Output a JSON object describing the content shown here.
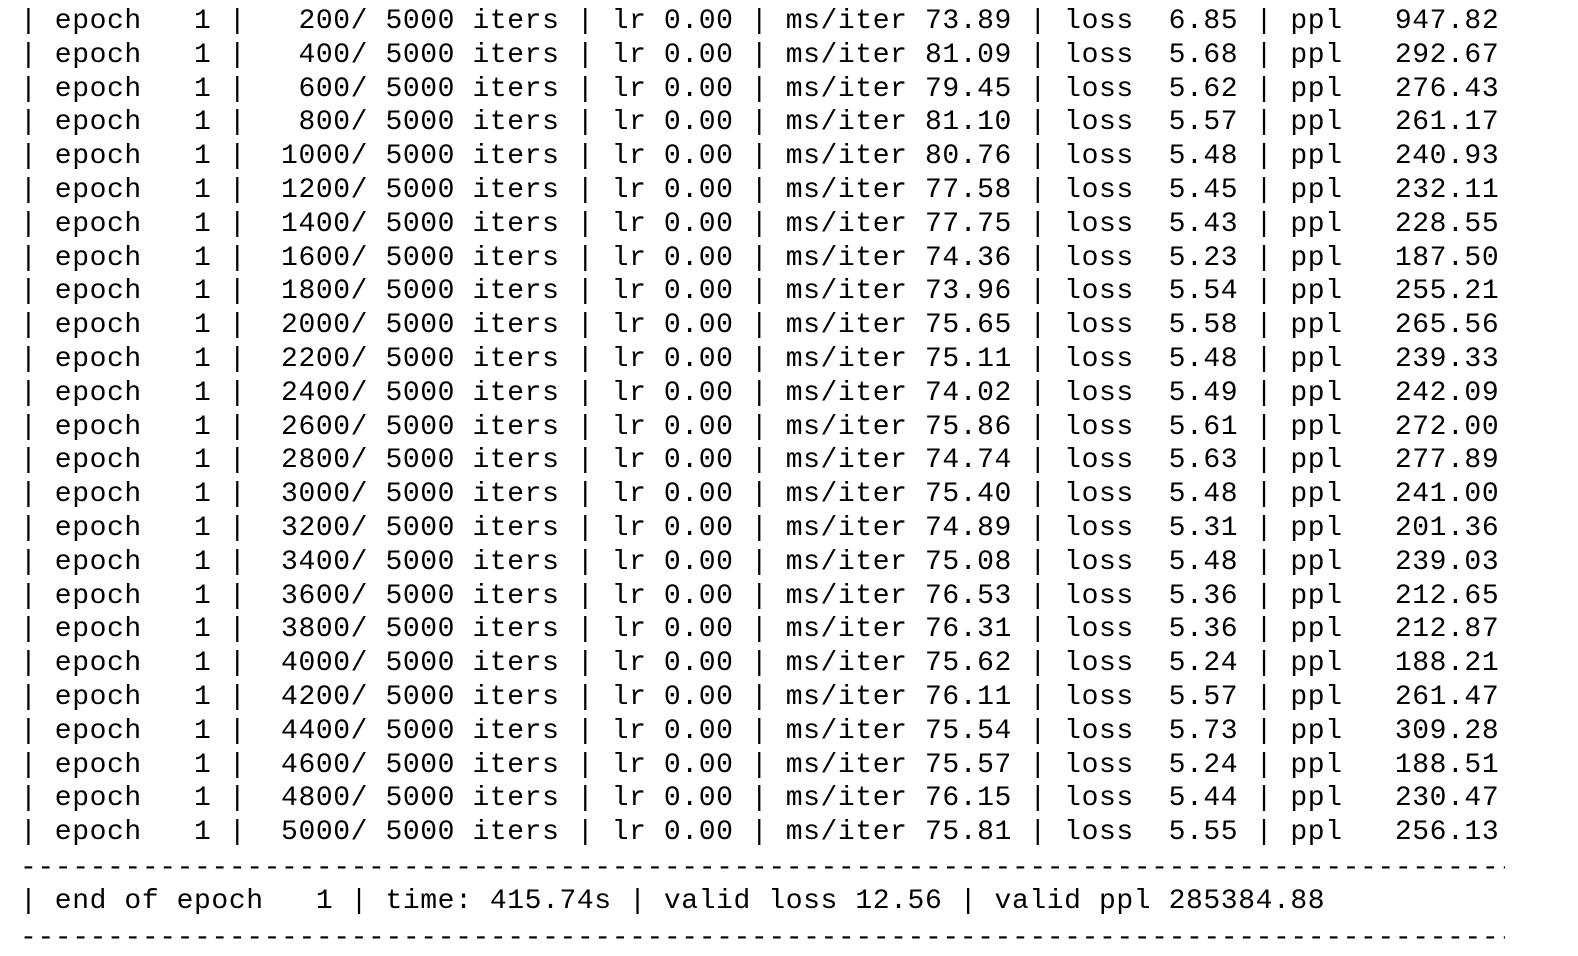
{
  "terminal": {
    "lines": [
      "| epoch   1 |   200/ 5000 iters | lr 0.00 | ms/iter 73.89 | loss  6.85 | ppl   947.82",
      "| epoch   1 |   400/ 5000 iters | lr 0.00 | ms/iter 81.09 | loss  5.68 | ppl   292.67",
      "| epoch   1 |   600/ 5000 iters | lr 0.00 | ms/iter 79.45 | loss  5.62 | ppl   276.43",
      "| epoch   1 |   800/ 5000 iters | lr 0.00 | ms/iter 81.10 | loss  5.57 | ppl   261.17",
      "| epoch   1 |  1000/ 5000 iters | lr 0.00 | ms/iter 80.76 | loss  5.48 | ppl   240.93",
      "| epoch   1 |  1200/ 5000 iters | lr 0.00 | ms/iter 77.58 | loss  5.45 | ppl   232.11",
      "| epoch   1 |  1400/ 5000 iters | lr 0.00 | ms/iter 77.75 | loss  5.43 | ppl   228.55",
      "| epoch   1 |  1600/ 5000 iters | lr 0.00 | ms/iter 74.36 | loss  5.23 | ppl   187.50",
      "| epoch   1 |  1800/ 5000 iters | lr 0.00 | ms/iter 73.96 | loss  5.54 | ppl   255.21",
      "| epoch   1 |  2000/ 5000 iters | lr 0.00 | ms/iter 75.65 | loss  5.58 | ppl   265.56",
      "| epoch   1 |  2200/ 5000 iters | lr 0.00 | ms/iter 75.11 | loss  5.48 | ppl   239.33",
      "| epoch   1 |  2400/ 5000 iters | lr 0.00 | ms/iter 74.02 | loss  5.49 | ppl   242.09",
      "| epoch   1 |  2600/ 5000 iters | lr 0.00 | ms/iter 75.86 | loss  5.61 | ppl   272.00",
      "| epoch   1 |  2800/ 5000 iters | lr 0.00 | ms/iter 74.74 | loss  5.63 | ppl   277.89",
      "| epoch   1 |  3000/ 5000 iters | lr 0.00 | ms/iter 75.40 | loss  5.48 | ppl   241.00",
      "| epoch   1 |  3200/ 5000 iters | lr 0.00 | ms/iter 74.89 | loss  5.31 | ppl   201.36",
      "| epoch   1 |  3400/ 5000 iters | lr 0.00 | ms/iter 75.08 | loss  5.48 | ppl   239.03",
      "| epoch   1 |  3600/ 5000 iters | lr 0.00 | ms/iter 76.53 | loss  5.36 | ppl   212.65",
      "| epoch   1 |  3800/ 5000 iters | lr 0.00 | ms/iter 76.31 | loss  5.36 | ppl   212.87",
      "| epoch   1 |  4000/ 5000 iters | lr 0.00 | ms/iter 75.62 | loss  5.24 | ppl   188.21",
      "| epoch   1 |  4200/ 5000 iters | lr 0.00 | ms/iter 76.11 | loss  5.57 | ppl   261.47",
      "| epoch   1 |  4400/ 5000 iters | lr 0.00 | ms/iter 75.54 | loss  5.73 | ppl   309.28",
      "| epoch   1 |  4600/ 5000 iters | lr 0.00 | ms/iter 75.57 | loss  5.24 | ppl   188.51",
      "| epoch   1 |  4800/ 5000 iters | lr 0.00 | ms/iter 76.15 | loss  5.44 | ppl   230.47",
      "| epoch   1 |  5000/ 5000 iters | lr 0.00 | ms/iter 75.81 | loss  5.55 | ppl   256.13"
    ],
    "divider": "-----------------------------------------------------------------------------------------",
    "summary": "| end of epoch   1 | time: 415.74s | valid loss 12.56 | valid ppl 285384.88",
    "colors": {
      "background": "#ffffff",
      "text": "#000000"
    }
  }
}
